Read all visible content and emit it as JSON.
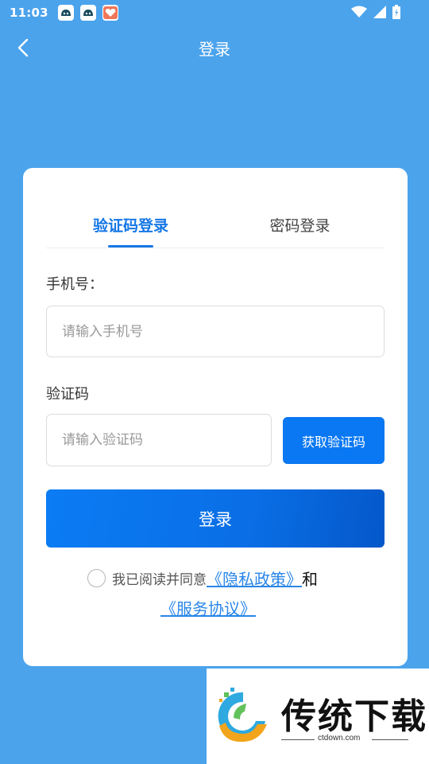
{
  "status_bar": {
    "time": "11:03"
  },
  "header": {
    "title": "登录"
  },
  "tabs": [
    {
      "label": "验证码登录",
      "active": true
    },
    {
      "label": "密码登录",
      "active": false
    }
  ],
  "phone": {
    "label": "手机号：",
    "placeholder": "请输入手机号",
    "value": ""
  },
  "code": {
    "label": "验证码",
    "placeholder": "请输入验证码",
    "value": "",
    "button_label": "获取验证码"
  },
  "login_button_label": "登录",
  "agreement": {
    "checked": false,
    "prefix": "我已阅读并同意",
    "privacy_link": "《隐私政策》",
    "and": "和",
    "service_link": "《服务协议》"
  },
  "watermark": {
    "title": "传统下载",
    "subtitle": "ctdown.com"
  },
  "colors": {
    "background": "#4ba3ec",
    "accent": "#1677e6",
    "button": "#0a78f2"
  }
}
